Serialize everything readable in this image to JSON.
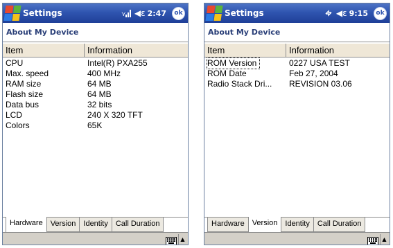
{
  "screens": [
    {
      "app_title": "Settings",
      "time": "2:47",
      "ok_label": "ok",
      "page_title": "About My Device",
      "columns": [
        "Item",
        "Information"
      ],
      "rows": [
        {
          "item": "CPU",
          "info": "Intel(R) PXA255"
        },
        {
          "item": "Max. speed",
          "info": "400 MHz"
        },
        {
          "item": "RAM size",
          "info": "64 MB"
        },
        {
          "item": "Flash size",
          "info": "64 MB"
        },
        {
          "item": "Data bus",
          "info": "32 bits"
        },
        {
          "item": "LCD",
          "info": "240 X 320 TFT"
        },
        {
          "item": "Colors",
          "info": "65K"
        }
      ],
      "tabs": [
        "Hardware",
        "Version",
        "Identity",
        "Call Duration"
      ],
      "active_tab": "Hardware"
    },
    {
      "app_title": "Settings",
      "time": "9:15",
      "ok_label": "ok",
      "page_title": "About My Device",
      "columns": [
        "Item",
        "Information"
      ],
      "rows": [
        {
          "item": "ROM Version",
          "info": "0227 USA TEST"
        },
        {
          "item": "ROM Date",
          "info": "Feb 27, 2004"
        },
        {
          "item": "Radio Stack Dri...",
          "info": "REVISION 03.06"
        }
      ],
      "tabs": [
        "Hardware",
        "Version",
        "Identity",
        "Call Duration"
      ],
      "active_tab": "Version"
    }
  ],
  "colors": {
    "titlebar": "#2f55b0",
    "header_bg": "#efe7d7",
    "page_title": "#2a3f78",
    "bottombar": "#d4d0c8"
  }
}
